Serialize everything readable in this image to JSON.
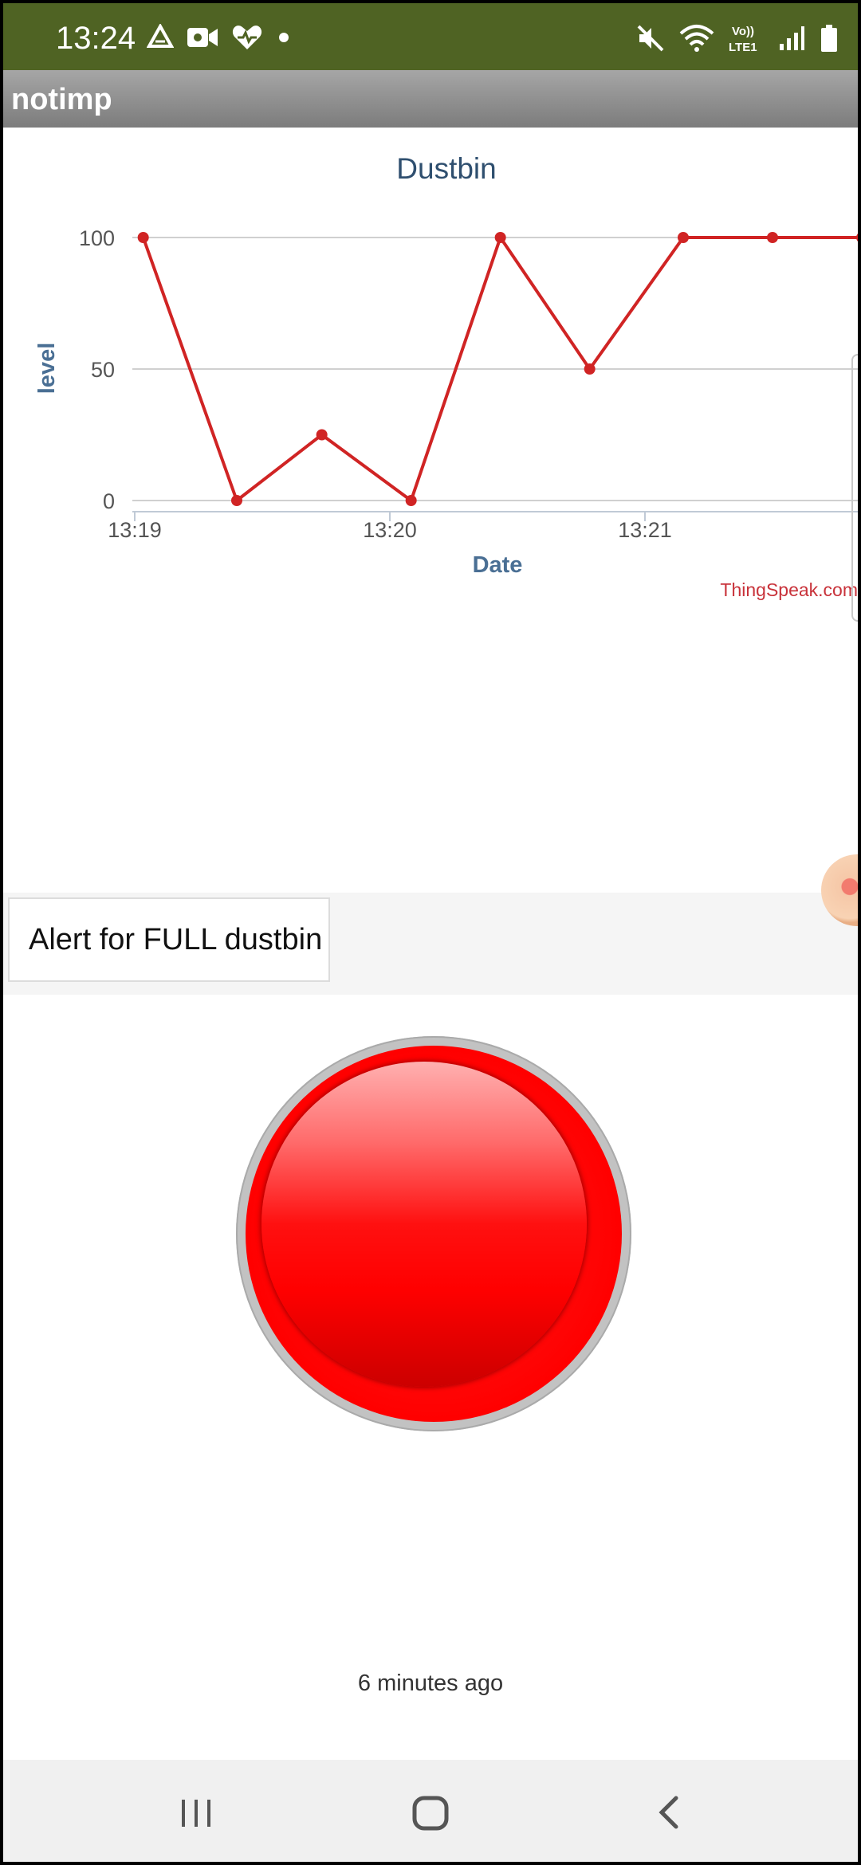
{
  "status_bar": {
    "time": "13:24",
    "left_icons": [
      "drive-icon",
      "video-camera-icon",
      "heart-icon",
      "dot-icon"
    ],
    "right_icons": [
      "mute-icon",
      "wifi-icon",
      "volte-icon",
      "signal-icon",
      "battery-icon"
    ],
    "volte_top": "Vo))",
    "volte_bottom": "LTE1"
  },
  "app_bar": {
    "title": "notimp"
  },
  "chart_data": {
    "type": "line",
    "title": "Dustbin",
    "xlabel": "Date",
    "ylabel": "level",
    "ylim": [
      0,
      100
    ],
    "y_ticks": [
      "0",
      "50",
      "100"
    ],
    "x_ticks": [
      "13:19",
      "13:20",
      "13:21"
    ],
    "x_range_minutes": [
      13.19,
      13.217
    ],
    "series": [
      {
        "color": "#d02424",
        "x": [
          "13:19:02",
          "13:19:24",
          "13:19:44",
          "13:20:05",
          "13:20:26",
          "13:20:47",
          "13:21:09",
          "13:21:30",
          "13:21:51"
        ],
        "y": [
          100,
          0,
          25,
          0,
          100,
          50,
          100,
          100,
          100
        ]
      }
    ],
    "grid": true,
    "credit": "ThingSpeak.com"
  },
  "alert": {
    "text": "Alert for FULL dustbin"
  },
  "button": {
    "color": "#ff0000"
  },
  "last_update": "6 minutes ago",
  "nav": [
    "recent-apps-icon",
    "home-icon",
    "back-icon"
  ]
}
